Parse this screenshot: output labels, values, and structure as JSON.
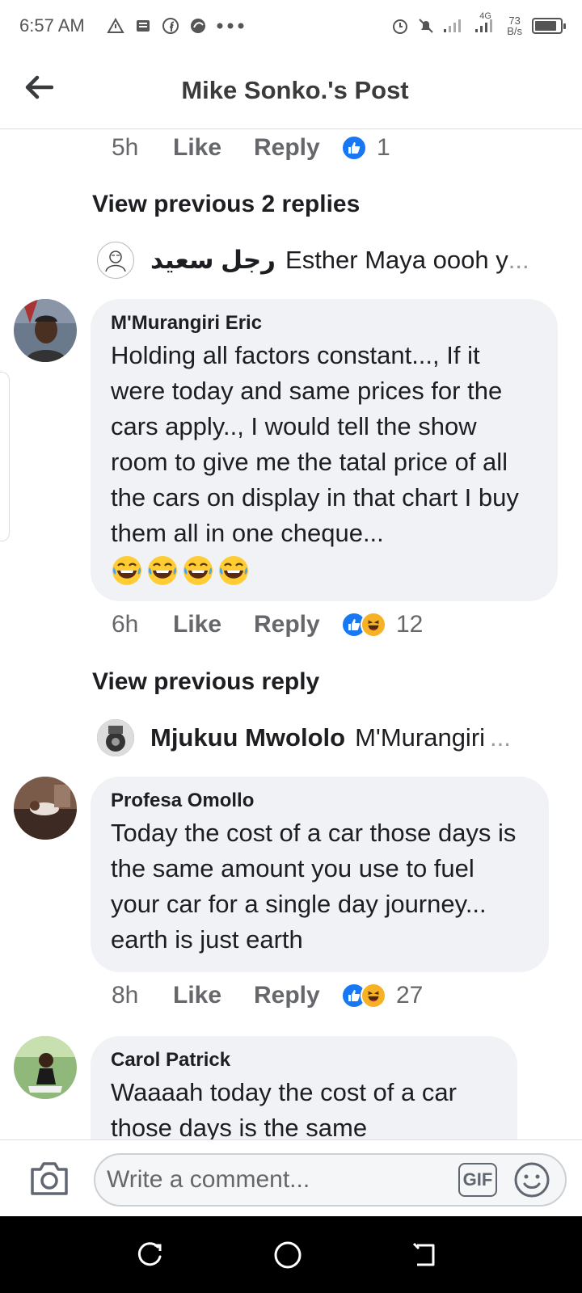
{
  "status_bar": {
    "time": "6:57 AM",
    "left_icons": [
      "warning-triangle-icon",
      "news-icon",
      "facebook-icon",
      "vpn-icon",
      "more-dots-icon"
    ],
    "network_type": "4G",
    "net_speed_value": "73",
    "net_speed_unit": "B/s"
  },
  "header": {
    "title": "Mike Sonko.'s Post"
  },
  "comments": {
    "top_meta": {
      "time": "5h",
      "like": "Like",
      "reply": "Reply",
      "count": "1"
    },
    "view_prev_1": "View previous 2 replies",
    "reply_preview_1": {
      "name": "رجل سعيد",
      "text": "Esther Maya oooh y",
      "ellipsis": "..."
    },
    "c1": {
      "name": "M'Murangiri Eric",
      "text": "Holding all factors constant..., If it were today and same prices for the cars apply.., I would tell the show room to give me the tatal price of all the cars on display in that chart I buy them all in one cheque...",
      "emoji_count": 4,
      "meta": {
        "time": "6h",
        "like": "Like",
        "reply": "Reply",
        "count": "12"
      }
    },
    "view_prev_2": "View previous reply",
    "reply_preview_2": {
      "name": "Mjukuu Mwololo",
      "text": "M'Murangiri",
      "ellipsis": "..."
    },
    "c2": {
      "name": "Profesa Omollo",
      "text": "Today the cost of a car those days is the same amount you use to fuel your car for a single day journey... earth is just earth",
      "meta": {
        "time": "8h",
        "like": "Like",
        "reply": "Reply",
        "count": "27"
      }
    },
    "c3": {
      "name": "Carol Patrick",
      "text": "Waaaah  today the cost of a car those days is the same"
    }
  },
  "composer": {
    "placeholder": "Write a comment...",
    "gif_label": "GIF"
  },
  "colors": {
    "like_blue": "#1877f2",
    "haha_yellow": "#f7b125",
    "bubble_bg": "#f0f2f5",
    "meta_gray": "#65676b"
  }
}
